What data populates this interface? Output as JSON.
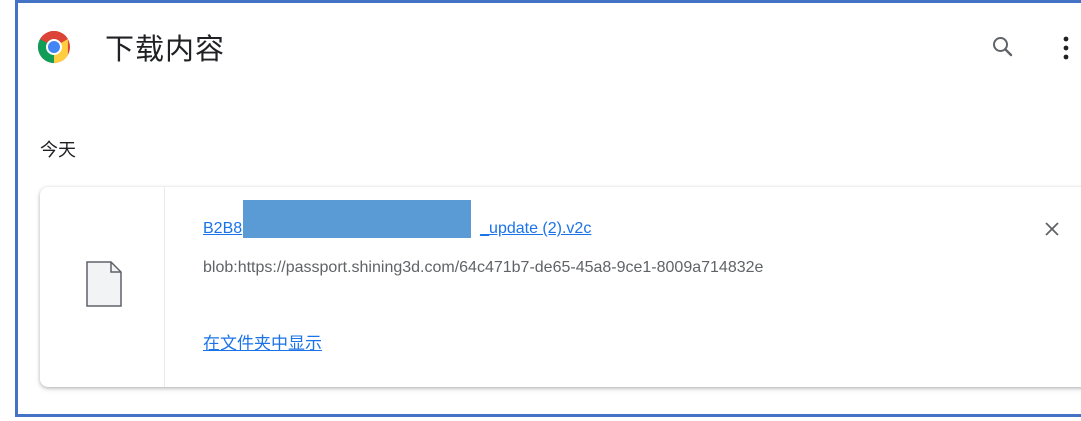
{
  "header": {
    "title": "下载内容",
    "logo_icon": "chrome-logo-icon",
    "search_icon": "search-icon",
    "menu_icon": "more-vert-icon"
  },
  "section": {
    "label": "今天"
  },
  "download": {
    "filename_prefix": "B2B8",
    "filename_suffix": "_update (2).v2c",
    "url": "blob:https://passport.shining3d.com/64c471b7-de65-45a8-9ce1-8009a714832e",
    "show_in_folder": "在文件夹中显示",
    "file_icon": "file-icon",
    "close_icon": "close-icon"
  },
  "colors": {
    "link": "#1a73e8",
    "frame": "#4472c4",
    "redaction": "#5b9bd5"
  }
}
